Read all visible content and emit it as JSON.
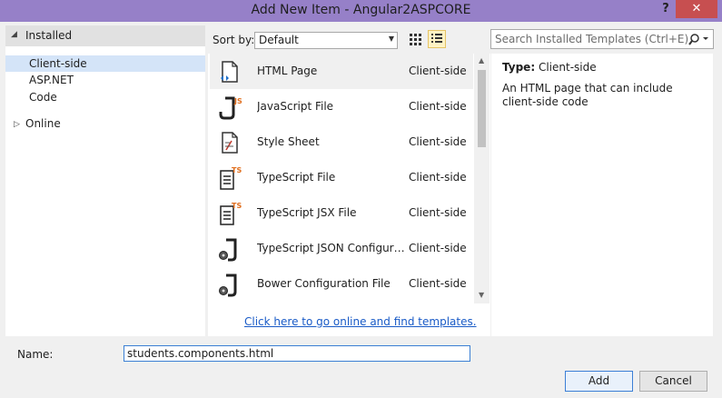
{
  "window": {
    "title": "Add New Item - Angular2ASPCORE",
    "help_label": "?",
    "close_label": "✕"
  },
  "left_pane": {
    "header": "Installed",
    "items": [
      "Client-side",
      "ASP.NET",
      "Code"
    ],
    "selected": "Client-side",
    "online_label": "Online"
  },
  "toolbar": {
    "sort_label": "Sort by:",
    "sort_value": "Default",
    "active_view": "list"
  },
  "search": {
    "placeholder": "Search Installed Templates (Ctrl+E)"
  },
  "templates": [
    {
      "name": "HTML Page",
      "category": "Client-side",
      "icon": "html-page-icon"
    },
    {
      "name": "JavaScript File",
      "category": "Client-side",
      "icon": "javascript-file-icon"
    },
    {
      "name": "Style Sheet",
      "category": "Client-side",
      "icon": "style-sheet-icon"
    },
    {
      "name": "TypeScript File",
      "category": "Client-side",
      "icon": "typescript-file-icon"
    },
    {
      "name": "TypeScript JSX File",
      "category": "Client-side",
      "icon": "typescript-jsx-file-icon"
    },
    {
      "name": "TypeScript JSON Configuration File",
      "category": "Client-side",
      "icon": "json-config-icon"
    },
    {
      "name": "Bower Configuration File",
      "category": "Client-side",
      "icon": "bower-config-icon"
    }
  ],
  "online_link": "Click here to go online and find templates.",
  "details": {
    "type_label": "Type:",
    "type_value": "Client-side",
    "description": "An HTML page that can include client-side code"
  },
  "name_field": {
    "label": "Name:",
    "value": "students.components.html"
  },
  "buttons": {
    "add": "Add",
    "cancel": "Cancel"
  },
  "colors": {
    "titlebar": "#9680c8",
    "close": "#c74f50",
    "selection": "#d4e4f8",
    "link": "#1a5bc7"
  }
}
